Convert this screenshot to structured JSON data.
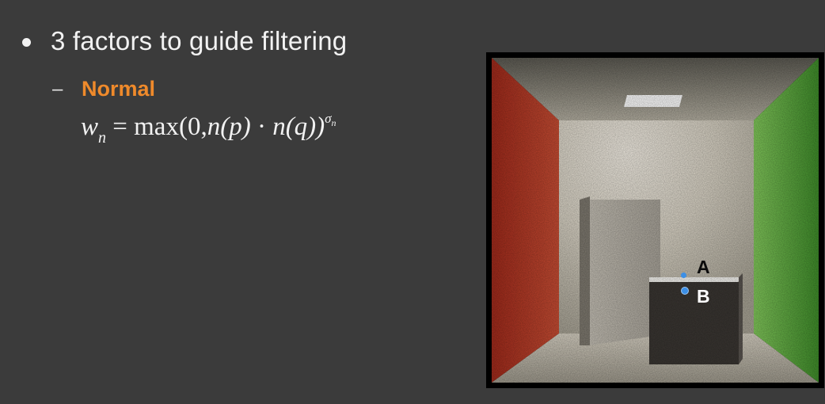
{
  "bullet": {
    "text": "3 factors to guide filtering"
  },
  "sub_item": {
    "dash": "–",
    "label": "Normal"
  },
  "formula": {
    "lhs": "w",
    "lhs_sub": "n",
    "rhs_prefix": "max(0,",
    "term1": "n(p)",
    "dot": "·",
    "term2": "n(q))",
    "exponent": "σ",
    "exponent_sub": "n"
  },
  "render": {
    "label_a": "A",
    "label_b": "B"
  },
  "colors": {
    "background": "#3b3b3b",
    "accent_orange": "#ef8a2b",
    "point_blue": "#3c8fe6",
    "left_wall": "#d9452f",
    "right_wall": "#5fb13f"
  }
}
